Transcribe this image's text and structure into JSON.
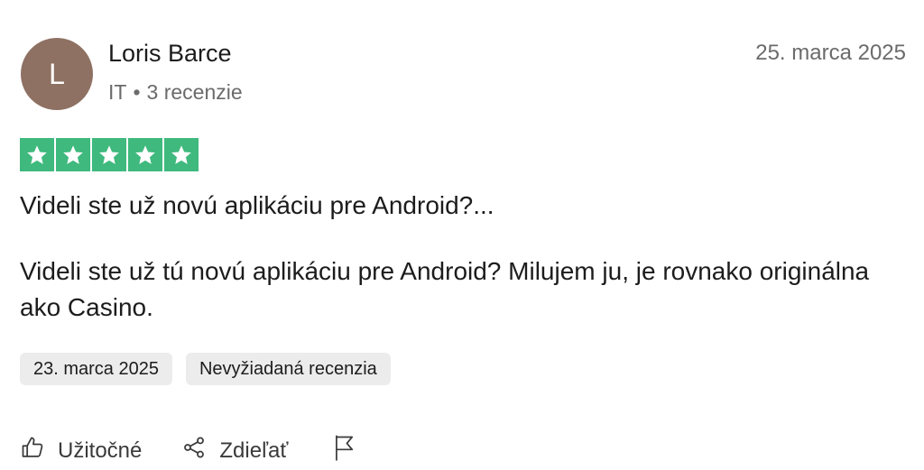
{
  "reviewer": {
    "initial": "L",
    "name": "Loris Barce",
    "country": "IT",
    "separator": "•",
    "reviews_count": "3 recenzie",
    "avatar_color": "#8e7163"
  },
  "review": {
    "date": "25. marca 2025",
    "rating": 5,
    "star_color": "#3fb97d",
    "title": "Videli ste už novú aplikáciu pre Android?...",
    "body": "Videli ste už tú novú aplikáciu pre Android? Milujem ju, je rovnako originálna ako Casino."
  },
  "chips": {
    "experience_date": "23. marca 2025",
    "label": "Nevyžiadaná recenzia"
  },
  "actions": {
    "useful_label": "Užitočné",
    "useful_icon": "thumbs-up-icon",
    "share_label": "Zdieľať",
    "share_icon": "share-icon",
    "report_icon": "flag-icon"
  }
}
